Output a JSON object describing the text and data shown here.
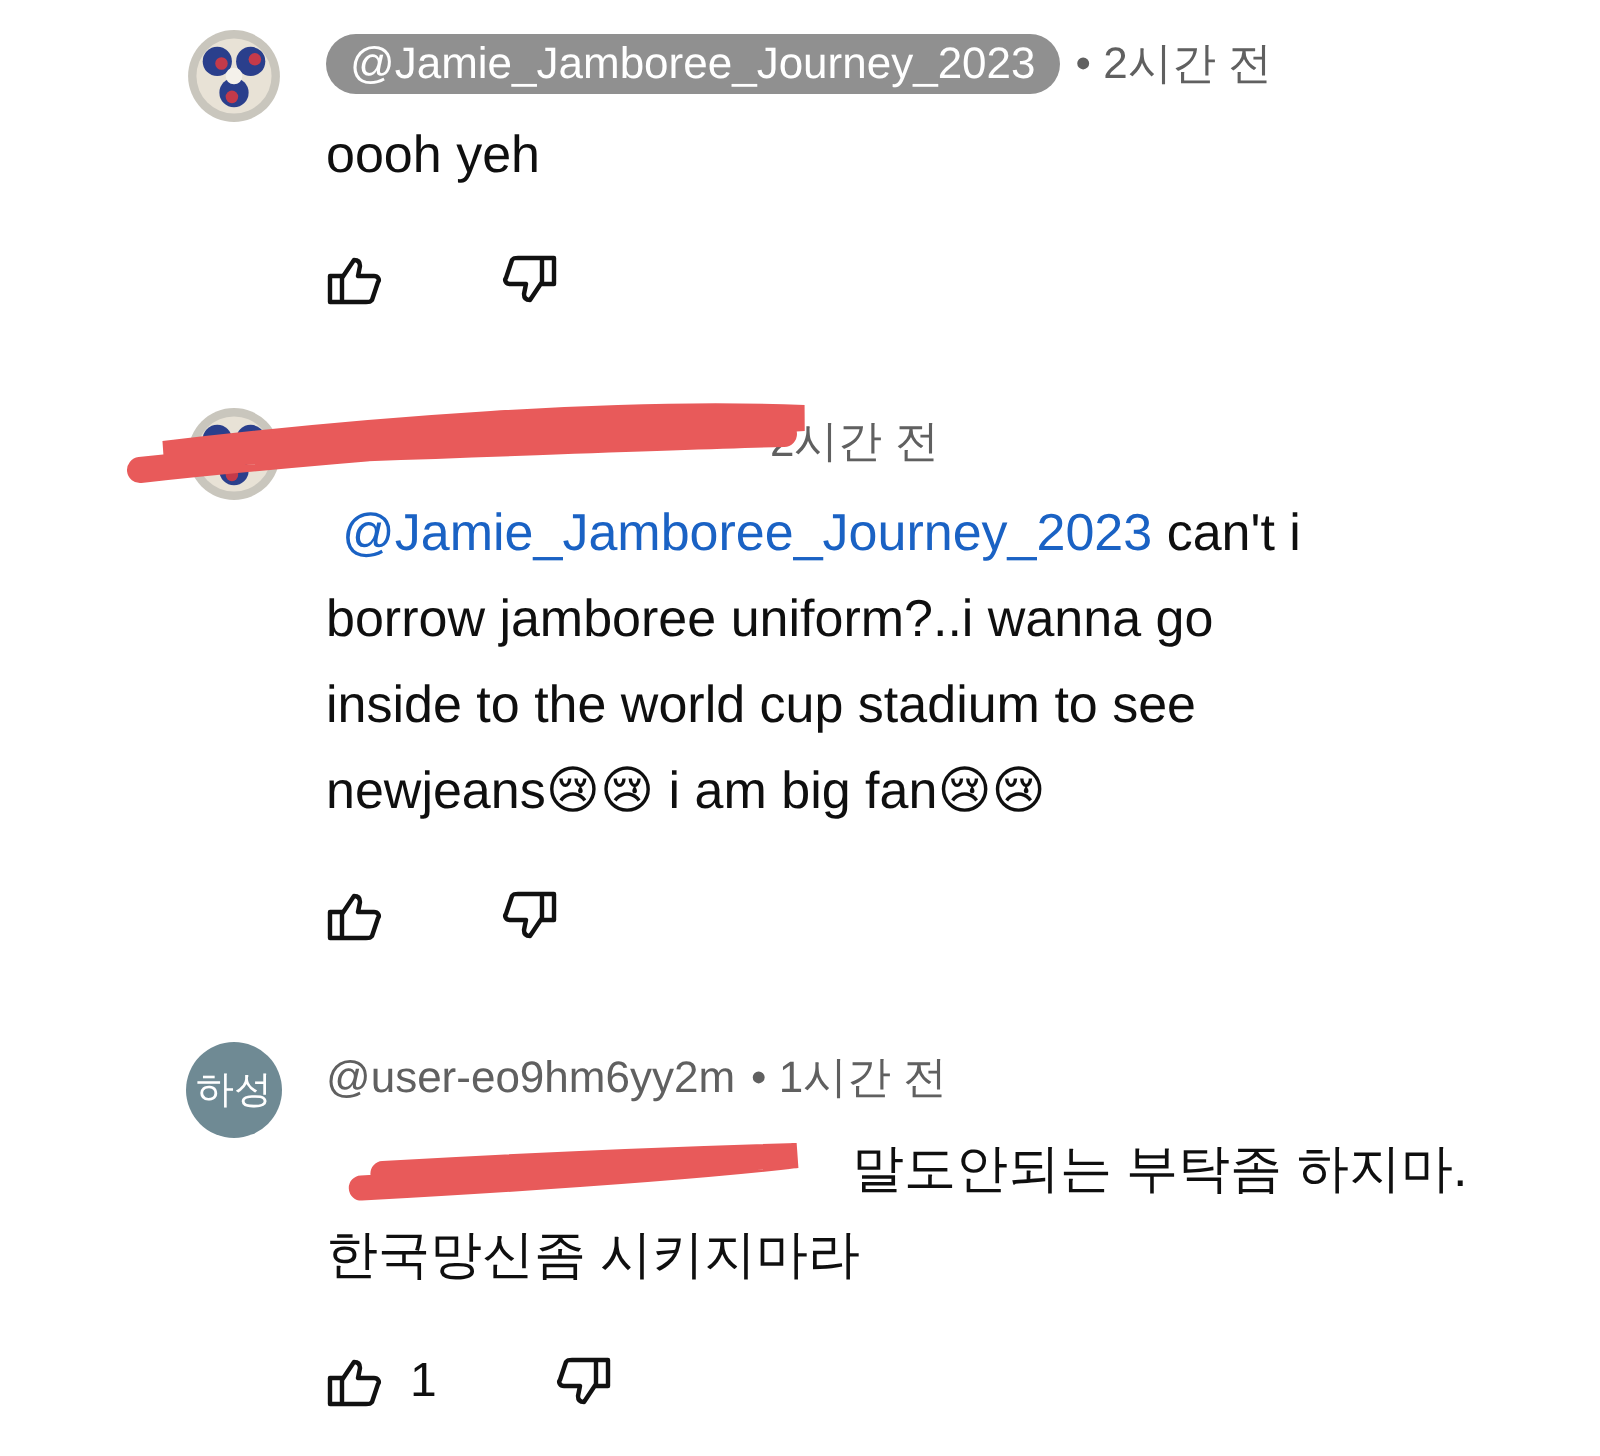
{
  "comments": [
    {
      "avatar": {
        "kind": "picture"
      },
      "author": {
        "name": "@Jamie_Jamboree_Journey_2023",
        "highlighted": true,
        "redacted": false
      },
      "time": "• 2시간 전",
      "mention": {
        "redacted": false
      },
      "lines": [
        "oooh yeh"
      ]
    },
    {
      "avatar": {
        "kind": "picture"
      },
      "author": {
        "redacted": true
      },
      "time": "2시간 전",
      "mention": {
        "text": "@Jamie_Jamboree_Journey_2023",
        "redacted": false
      },
      "lines": [
        "can't i",
        "borrow jamboree uniform?..i wanna go",
        "inside to the world cup stadium to see",
        "newjeans😢😢 i am big fan😢😢"
      ]
    },
    {
      "avatar": {
        "kind": "initials",
        "text": "하성"
      },
      "author": {
        "name": "@user-eo9hm6yy2m",
        "highlighted": false,
        "redacted": false
      },
      "time": "• 1시간 전",
      "mention": {
        "redacted": true
      },
      "lines": [
        "말도안되는 부탁좀 하지마.",
        "한국망신좀 시키지마라"
      ],
      "likes": "1"
    }
  ]
}
